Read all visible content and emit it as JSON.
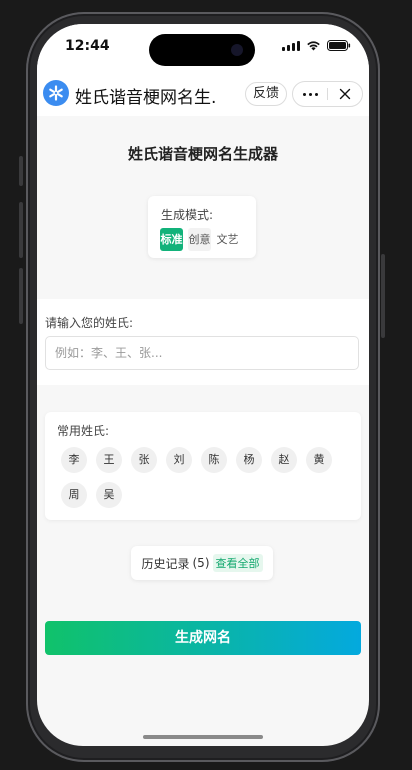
{
  "status_bar": {
    "time": "12:44"
  },
  "nav": {
    "title": "姓氏谐音梗网名生...",
    "feedback_label": "反馈"
  },
  "page": {
    "title": "姓氏谐音梗网名生成器"
  },
  "mode": {
    "label": "生成模式:",
    "options": [
      {
        "label": "标准",
        "selected": true
      },
      {
        "label": "创意",
        "selected": false
      },
      {
        "label": "文艺",
        "selected": false
      }
    ]
  },
  "surname_input": {
    "label": "请输入您的姓氏:",
    "placeholder": "例如：李、王、张...",
    "value": ""
  },
  "common_surnames": {
    "label": "常用姓氏:",
    "items": [
      "李",
      "王",
      "张",
      "刘",
      "陈",
      "杨",
      "赵",
      "黄",
      "周",
      "吴"
    ]
  },
  "history": {
    "label": "历史记录",
    "count": "(5)",
    "view_all_label": "查看全部"
  },
  "generate_button": {
    "label": "生成网名"
  },
  "colors": {
    "accent_green": "#12b27a",
    "gradient_start": "#10c26a",
    "gradient_end": "#04a9de",
    "logo_blue": "#3b8cf0"
  }
}
